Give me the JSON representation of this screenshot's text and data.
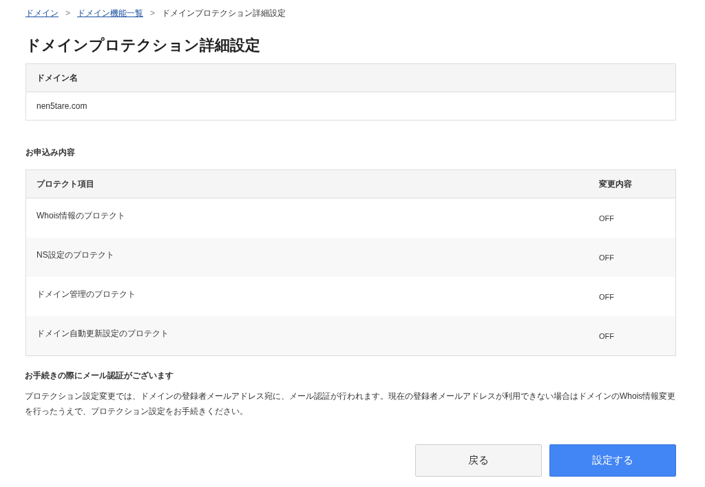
{
  "breadcrumb": [
    {
      "label": "ドメイン",
      "kind": "link"
    },
    {
      "label": "ドメイン機能一覧",
      "kind": "link"
    },
    {
      "label": "ドメインプロテクション詳細設定",
      "kind": "current"
    }
  ],
  "breadcrumb_separator": ">",
  "title": "ドメインプロテクション詳細設定",
  "domain_table": {
    "header": "ドメイン名",
    "value": "nen5tare.com"
  },
  "section_title": "お申込み内容",
  "protect_table": {
    "columns": [
      "プロテクト項目",
      "変更内容"
    ],
    "rows": [
      [
        "Whois情報のプロテクト",
        "OFF"
      ],
      [
        "NS設定のプロテクト",
        "OFF"
      ],
      [
        "ドメイン管理のプロテクト",
        "OFF"
      ],
      [
        "ドメイン自動更新設定のプロテクト",
        "OFF"
      ]
    ]
  },
  "notice": {
    "title": "お手続きの際にメール認証がございます",
    "body": "プロテクション設定変更では、ドメインの登録者メールアドレス宛に、メール認証が行われます。現在の登録者メールアドレスが利用できない場合はドメインのWhois情報変更を行ったうえで、プロテクション設定をお手続きください。"
  },
  "buttons": [
    {
      "label": "戻る",
      "kind": "secondary"
    },
    {
      "label": "設定する",
      "kind": "primary"
    }
  ]
}
